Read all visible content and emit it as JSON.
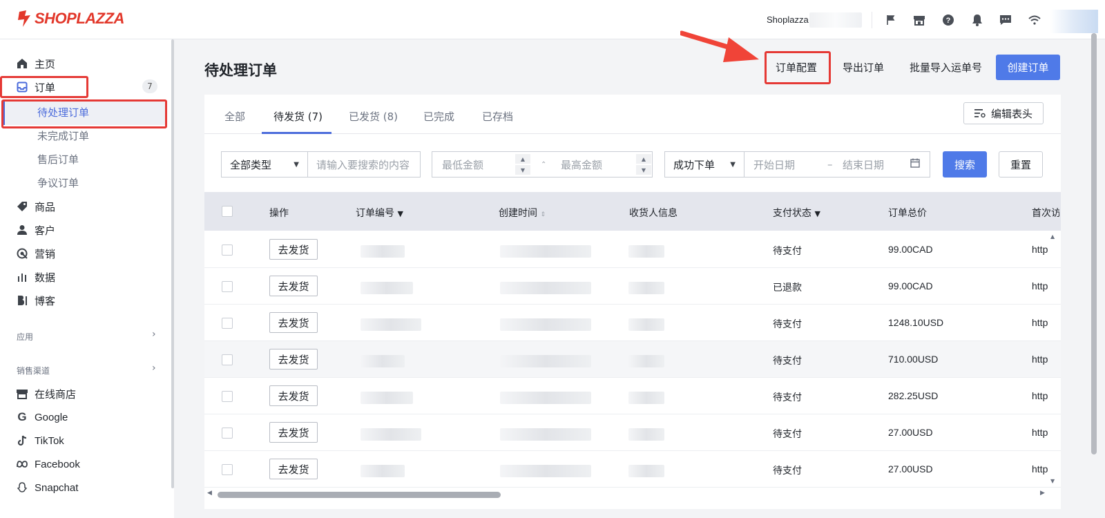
{
  "brand": {
    "name": "SHOPLAZZA",
    "color": "#e2372a"
  },
  "header": {
    "store_name": "Shoplazza",
    "icons": [
      "flag-icon",
      "store-icon",
      "help-icon",
      "bell-icon",
      "message-icon",
      "wifi-icon"
    ]
  },
  "sidebar": {
    "items": [
      {
        "label": "主页",
        "icon": "home-icon"
      },
      {
        "label": "订单",
        "icon": "inbox-icon",
        "badge": "7"
      },
      {
        "label": "商品",
        "icon": "tag-icon"
      },
      {
        "label": "客户",
        "icon": "user-icon"
      },
      {
        "label": "营销",
        "icon": "target-icon"
      },
      {
        "label": "数据",
        "icon": "bar-chart-icon"
      },
      {
        "label": "博客",
        "icon": "blog-icon"
      }
    ],
    "order_subitems": [
      "待处理订单",
      "未完成订单",
      "售后订单",
      "争议订单"
    ],
    "apps_section": "应用",
    "channels_section": "销售渠道",
    "channels": [
      {
        "label": "在线商店",
        "icon": "store-icon"
      },
      {
        "label": "Google",
        "icon": "google-icon"
      },
      {
        "label": "TikTok",
        "icon": "tiktok-icon"
      },
      {
        "label": "Facebook",
        "icon": "meta-icon"
      },
      {
        "label": "Snapchat",
        "icon": "snapchat-icon"
      }
    ]
  },
  "page": {
    "title": "待处理订单",
    "actions": {
      "config": "订单配置",
      "export": "导出订单",
      "import": "批量导入运单号",
      "create": "创建订单"
    },
    "accent": "#4f7ae8"
  },
  "tabs": [
    "全部",
    "待发货 (7)",
    "已发货 (8)",
    "已完成",
    "已存档"
  ],
  "edit_columns": "编辑表头",
  "filters": {
    "type": "全部类型",
    "search_placeholder": "请输入要搜索的内容",
    "min_amount": "最低金额",
    "max_amount": "最高金额",
    "order_status": "成功下单",
    "start_date": "开始日期",
    "end_date": "结束日期",
    "search_btn": "搜索",
    "reset_btn": "重置"
  },
  "table": {
    "columns": [
      "操作",
      "订单编号",
      "创建时间",
      "收货人信息",
      "支付状态",
      "订单总价",
      "首次访"
    ],
    "action_label": "去发货",
    "rows": [
      {
        "pay_status": "待支付",
        "total": "99.00CAD",
        "first_visit": "http"
      },
      {
        "pay_status": "已退款",
        "total": "99.00CAD",
        "first_visit": "http"
      },
      {
        "pay_status": "待支付",
        "total": "1248.10USD",
        "first_visit": "http"
      },
      {
        "pay_status": "待支付",
        "total": "710.00USD",
        "first_visit": "http"
      },
      {
        "pay_status": "待支付",
        "total": "282.25USD",
        "first_visit": "http"
      },
      {
        "pay_status": "待支付",
        "total": "27.00USD",
        "first_visit": "http"
      },
      {
        "pay_status": "待支付",
        "total": "27.00USD",
        "first_visit": "http"
      }
    ]
  }
}
